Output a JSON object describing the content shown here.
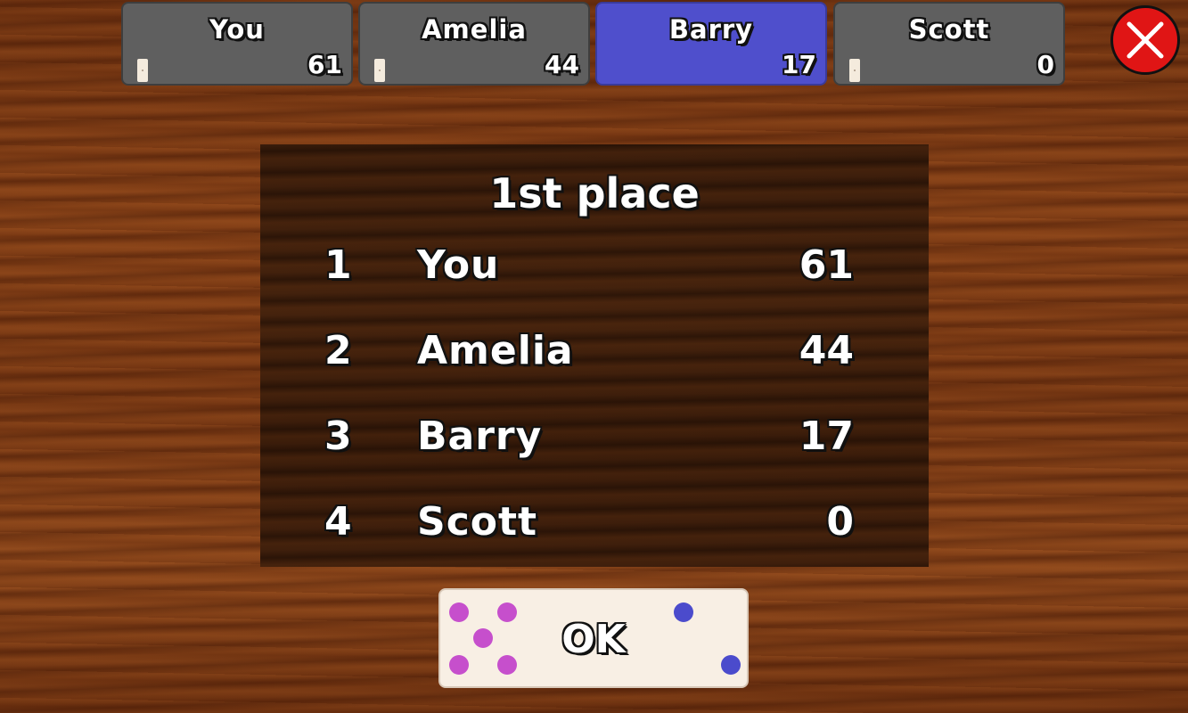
{
  "players": [
    {
      "name": "You",
      "score": "61",
      "active": false
    },
    {
      "name": "Amelia",
      "score": "44",
      "active": false
    },
    {
      "name": "Barry",
      "score": "17",
      "active": true
    },
    {
      "name": "Scott",
      "score": "0",
      "active": false
    }
  ],
  "colors": {
    "active_player": "#4f4fcc",
    "inactive_player": "#5f5f5f",
    "close_button": "#e01515",
    "pip_left": "#c64fcc",
    "pip_right": "#4b4bcc"
  },
  "close_icon": "close-x-icon",
  "results": {
    "title": "1st place",
    "rows": [
      {
        "rank": "1",
        "name": "You",
        "score": "61"
      },
      {
        "rank": "2",
        "name": "Amelia",
        "score": "44"
      },
      {
        "rank": "3",
        "name": "Barry",
        "score": "17"
      },
      {
        "rank": "4",
        "name": "Scott",
        "score": "0"
      }
    ]
  },
  "ok_button": {
    "label": "OK",
    "domino_left_pips": 5,
    "domino_right_pips": 2
  }
}
